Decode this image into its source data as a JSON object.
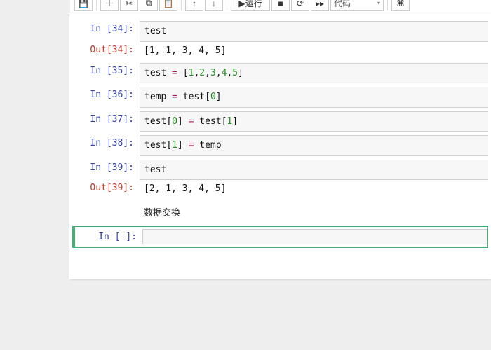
{
  "toolbar": {
    "run_label": "运行",
    "celltype": "代码"
  },
  "cells": {
    "c34": {
      "in_prompt": "In [34]:",
      "code": "test",
      "out_prompt": "Out[34]:",
      "out": "[1, 1, 3, 4, 5]"
    },
    "c35": {
      "in_prompt": "In [35]:",
      "code_html": "<span class='tok-name'>test</span> <span class='tok-op'>=</span> <span class='tok-punc'>[</span><span class='tok-num'>1</span>,<span class='tok-num'>2</span>,<span class='tok-num'>3</span>,<span class='tok-num'>4</span>,<span class='tok-num'>5</span><span class='tok-punc'>]</span>"
    },
    "c36": {
      "in_prompt": "In [36]:",
      "code_html": "<span class='tok-name'>temp</span> <span class='tok-op'>=</span> <span class='tok-name'>test</span><span class='tok-punc'>[</span><span class='tok-num'>0</span><span class='tok-punc'>]</span>"
    },
    "c37": {
      "in_prompt": "In [37]:",
      "code_html": "<span class='tok-name'>test</span><span class='tok-punc'>[</span><span class='tok-num'>0</span><span class='tok-punc'>]</span> <span class='tok-op'>=</span> <span class='tok-name'>test</span><span class='tok-punc'>[</span><span class='tok-num'>1</span><span class='tok-punc'>]</span>"
    },
    "c38": {
      "in_prompt": "In [38]:",
      "code_html": "<span class='tok-name'>test</span><span class='tok-punc'>[</span><span class='tok-num'>1</span><span class='tok-punc'>]</span> <span class='tok-op'>=</span> <span class='tok-name'>temp</span>"
    },
    "c39": {
      "in_prompt": "In [39]:",
      "code": "test",
      "out_prompt": "Out[39]:",
      "out": "[2, 1, 3, 4, 5]"
    },
    "md": {
      "text": "数据交换"
    },
    "cE": {
      "in_prompt": "In [ ]:",
      "code": ""
    }
  }
}
